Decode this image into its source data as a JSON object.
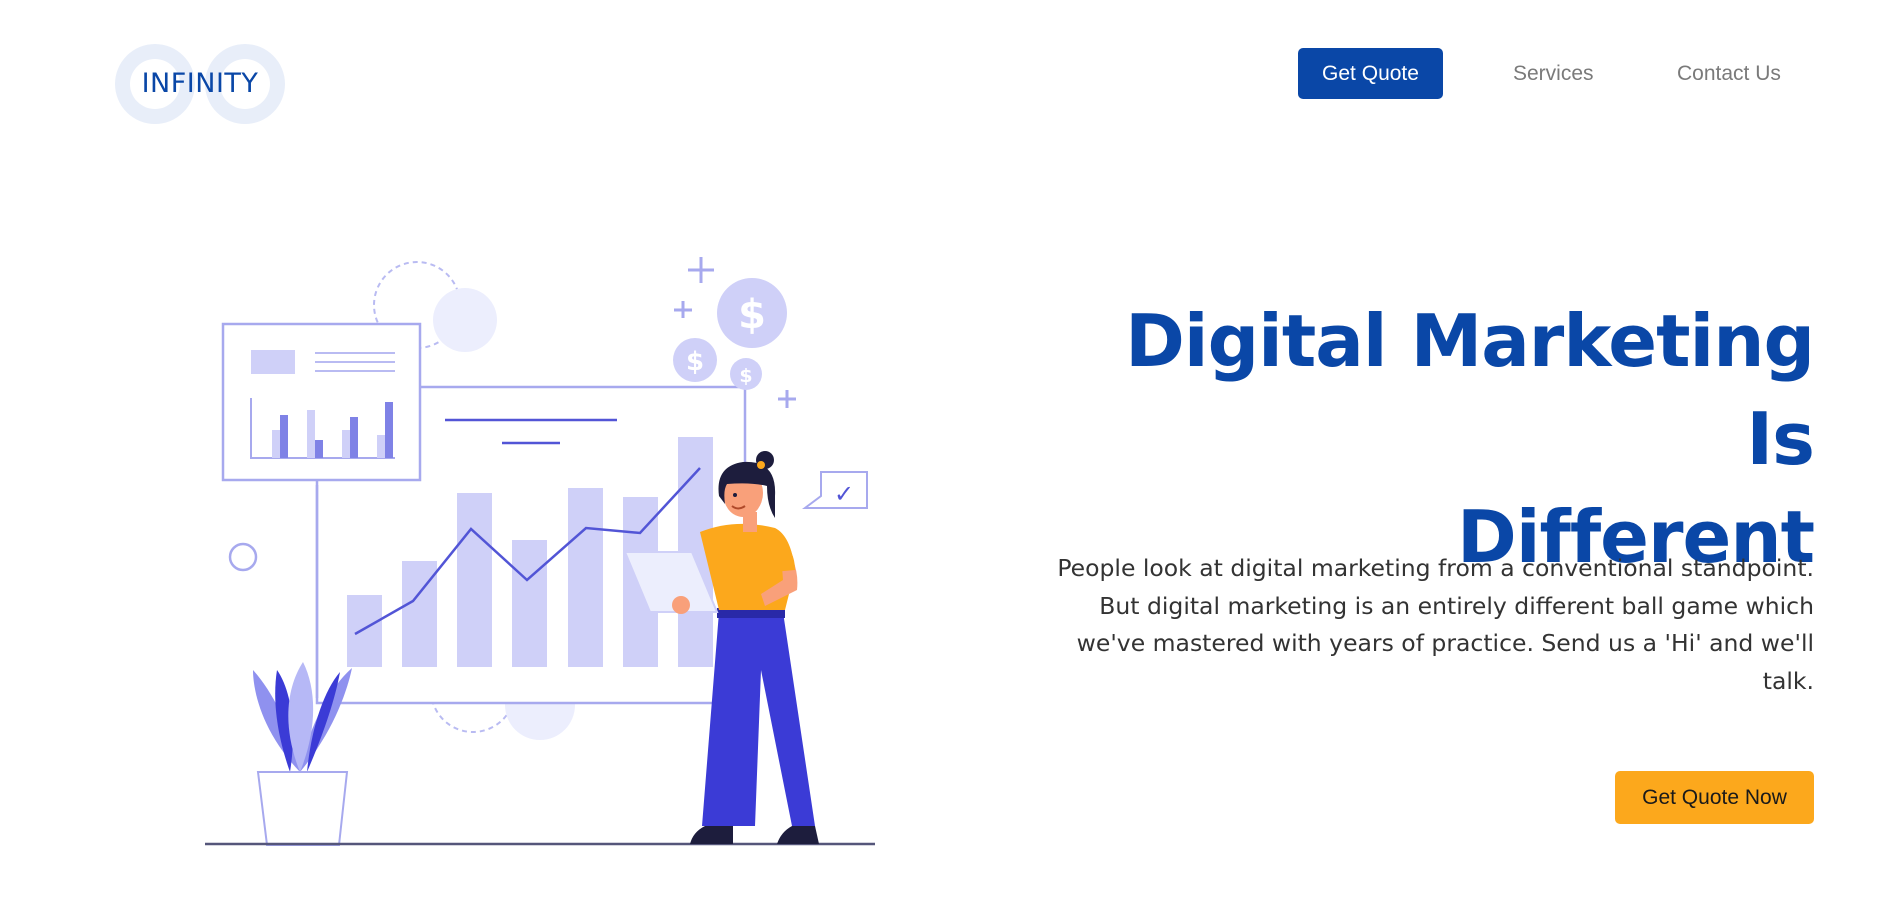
{
  "header": {
    "logo_text": "INFINITY",
    "nav": {
      "get_quote_label": "Get Quote",
      "services_label": "Services",
      "contact_label": "Contact Us"
    }
  },
  "hero": {
    "title_line1": "Digital Marketing Is",
    "title_line2": "Different",
    "description": "People look at digital marketing from a conventional standpoint. But digital marketing is an entirely different ball game which we've mastered with years of practice. Send us a 'Hi' and we'll talk.",
    "cta_label": "Get Quote Now"
  },
  "colors": {
    "brand_blue": "#0a47a7",
    "accent_orange": "#fca81c",
    "illustration_purple": "#3b3bd6",
    "illustration_light": "#cfd0f8"
  },
  "illustration": {
    "currency_symbol": "$",
    "check_symbol": "✓"
  }
}
